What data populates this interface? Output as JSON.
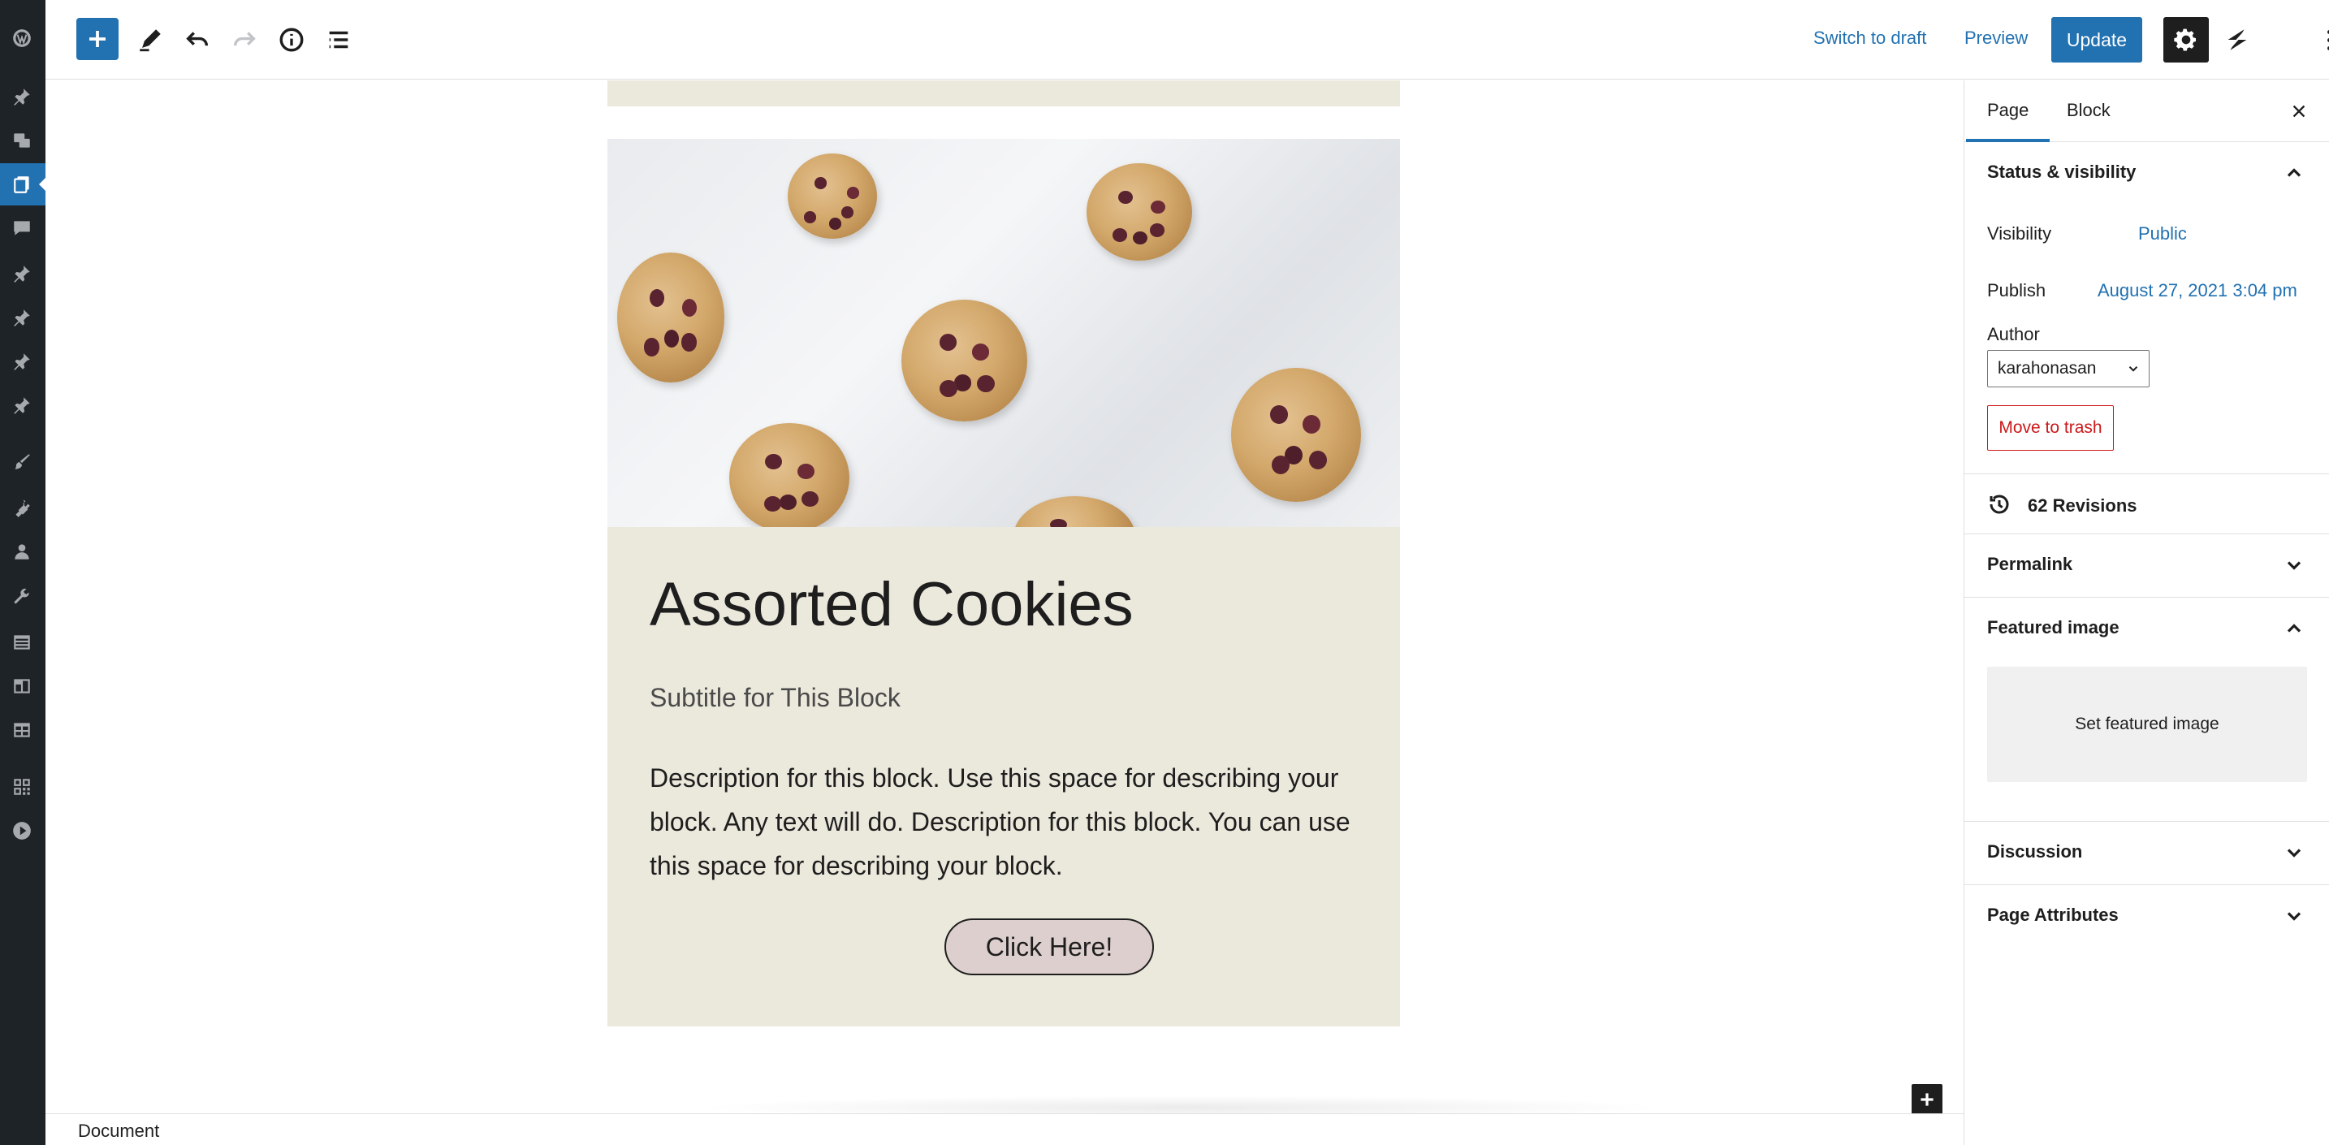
{
  "admin_menu": {
    "icons": [
      "wordpress-logo",
      "posts",
      "media",
      "pages",
      "comments",
      "pin-1",
      "pin-2",
      "pin-3",
      "pin-4",
      "appearance",
      "plugins",
      "users",
      "tools",
      "table-1",
      "table-2",
      "table-3",
      "grid",
      "play"
    ],
    "active": "pages"
  },
  "toolbar": {
    "switch_to_draft": "Switch to draft",
    "preview": "Preview",
    "update": "Update"
  },
  "block": {
    "title": "Assorted Cookies",
    "subtitle": "Subtitle for This Block",
    "description": "Description for this block. Use this space for describing your block. Any text will do. Description for this block. You can use this space for describing your block.",
    "button": "Click Here!"
  },
  "footer": {
    "breadcrumb": "Document"
  },
  "sidebar": {
    "tabs": [
      "Page",
      "Block"
    ],
    "active_tab": "Page",
    "status_visibility": {
      "title": "Status & visibility",
      "visibility_label": "Visibility",
      "visibility_value": "Public",
      "publish_label": "Publish",
      "publish_value": "August 27, 2021 3:04 pm",
      "author_label": "Author",
      "author_value": "karahonasan",
      "trash": "Move to trash"
    },
    "revisions": "62 Revisions",
    "permalink": "Permalink",
    "featured_image": {
      "title": "Featured image",
      "set": "Set featured image"
    },
    "discussion": "Discussion",
    "page_attributes": "Page Attributes"
  },
  "colors": {
    "accent": "#2271b1",
    "admin_bg": "#1d2327",
    "card_bg": "#ebe8dc",
    "button_bg": "#ddcfce",
    "danger": "#cc1818"
  }
}
